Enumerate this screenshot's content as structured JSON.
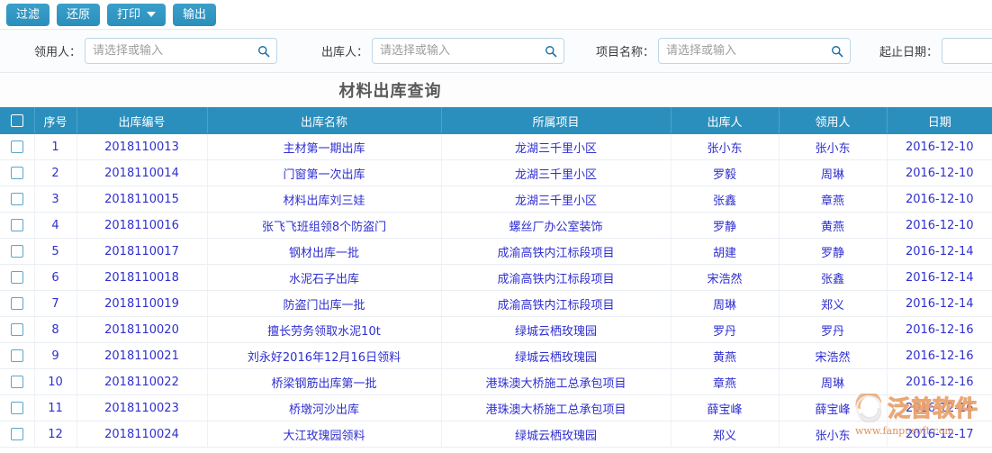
{
  "toolbar": {
    "buttons": [
      {
        "label": "过滤",
        "name": "filter-button",
        "caret": false
      },
      {
        "label": "还原",
        "name": "reset-button",
        "caret": false
      },
      {
        "label": "打印",
        "name": "print-button",
        "caret": true
      },
      {
        "label": "输出",
        "name": "export-button",
        "caret": false
      }
    ]
  },
  "filters": {
    "receiver": {
      "label": "领用人：",
      "placeholder": "请选择或输入",
      "value": ""
    },
    "issuer": {
      "label": "出库人：",
      "placeholder": "请选择或输入",
      "value": ""
    },
    "project": {
      "label": "项目名称：",
      "placeholder": "请选择或输入",
      "value": ""
    },
    "daterange": {
      "label": "起止日期：",
      "placeholder": "",
      "value": ""
    }
  },
  "page": {
    "title": "材料出库查询"
  },
  "table": {
    "columns": [
      {
        "key": "check",
        "label": ""
      },
      {
        "key": "index",
        "label": "序号"
      },
      {
        "key": "code",
        "label": "出库编号"
      },
      {
        "key": "name",
        "label": "出库名称"
      },
      {
        "key": "project",
        "label": "所属项目"
      },
      {
        "key": "issuer",
        "label": "出库人"
      },
      {
        "key": "receiver",
        "label": "领用人"
      },
      {
        "key": "date",
        "label": "日期"
      }
    ],
    "rows": [
      {
        "index": "1",
        "code": "2018110013",
        "name": "主材第一期出库",
        "project": "龙湖三千里小区",
        "issuer": "张小东",
        "receiver": "张小东",
        "date": "2016-12-10"
      },
      {
        "index": "2",
        "code": "2018110014",
        "name": "门窗第一次出库",
        "project": "龙湖三千里小区",
        "issuer": "罗毅",
        "receiver": "周琳",
        "date": "2016-12-10"
      },
      {
        "index": "3",
        "code": "2018110015",
        "name": "材料出库刘三娃",
        "project": "龙湖三千里小区",
        "issuer": "张鑫",
        "receiver": "章燕",
        "date": "2016-12-10"
      },
      {
        "index": "4",
        "code": "2018110016",
        "name": "张飞飞班组领8个防盗门",
        "project": "螺丝厂办公室装饰",
        "issuer": "罗静",
        "receiver": "黄燕",
        "date": "2016-12-10"
      },
      {
        "index": "5",
        "code": "2018110017",
        "name": "钢材出库一批",
        "project": "成渝高铁内江标段项目",
        "issuer": "胡建",
        "receiver": "罗静",
        "date": "2016-12-14"
      },
      {
        "index": "6",
        "code": "2018110018",
        "name": "水泥石子出库",
        "project": "成渝高铁内江标段项目",
        "issuer": "宋浩然",
        "receiver": "张鑫",
        "date": "2016-12-14"
      },
      {
        "index": "7",
        "code": "2018110019",
        "name": "防盗门出库一批",
        "project": "成渝高铁内江标段项目",
        "issuer": "周琳",
        "receiver": "郑义",
        "date": "2016-12-14"
      },
      {
        "index": "8",
        "code": "2018110020",
        "name": "擅长劳务领取水泥10t",
        "project": "绿城云栖玫瑰园",
        "issuer": "罗丹",
        "receiver": "罗丹",
        "date": "2016-12-16"
      },
      {
        "index": "9",
        "code": "2018110021",
        "name": "刘永好2016年12月16日领料",
        "project": "绿城云栖玫瑰园",
        "issuer": "黄燕",
        "receiver": "宋浩然",
        "date": "2016-12-16"
      },
      {
        "index": "10",
        "code": "2018110022",
        "name": "桥梁钢筋出库第一批",
        "project": "港珠澳大桥施工总承包项目",
        "issuer": "章燕",
        "receiver": "周琳",
        "date": "2016-12-16"
      },
      {
        "index": "11",
        "code": "2018110023",
        "name": "桥墩河沙出库",
        "project": "港珠澳大桥施工总承包项目",
        "issuer": "薛宝峰",
        "receiver": "薛宝峰",
        "date": "2016-12-16"
      },
      {
        "index": "12",
        "code": "2018110024",
        "name": "大江玫瑰园领料",
        "project": "绿城云栖玫瑰园",
        "issuer": "郑义",
        "receiver": "张小东",
        "date": "2016-12-17"
      }
    ]
  },
  "watermark": {
    "text": "泛普软件",
    "url": "www.fanpusoft.com"
  },
  "colors": {
    "accent": "#2b8fbd",
    "header": "#2b8fbd",
    "link": "#2f2fd0",
    "watermark": "#d9884e"
  }
}
